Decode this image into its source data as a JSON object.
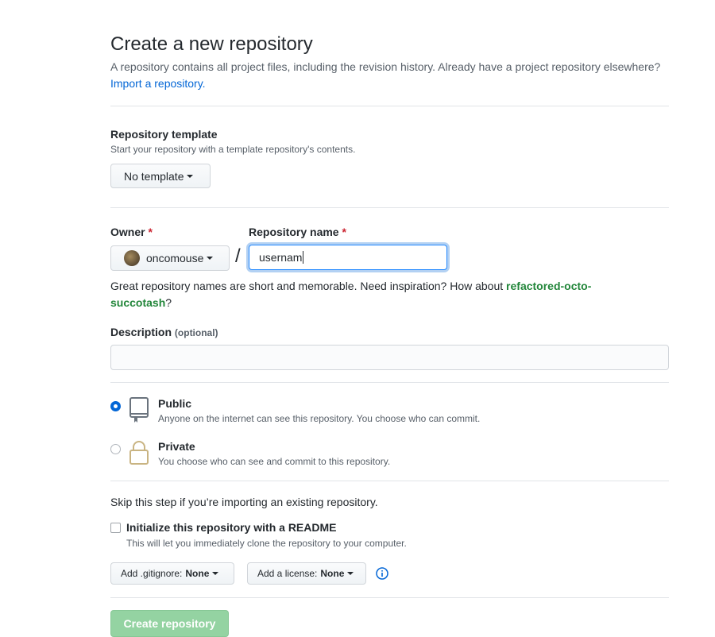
{
  "header": {
    "title": "Create a new repository",
    "intro_text": "A repository contains all project files, including the revision history. Already have a project repository elsewhere?",
    "import_link": "Import a repository."
  },
  "template": {
    "label": "Repository template",
    "note": "Start your repository with a template repository's contents.",
    "button_label": "No template"
  },
  "owner": {
    "label": "Owner",
    "required_mark": "*",
    "value": "oncomouse"
  },
  "separator": "/",
  "repo_name": {
    "label": "Repository name",
    "required_mark": "*",
    "value": "usernam"
  },
  "suggestion": {
    "text": "Great repository names are short and memorable. Need inspiration? How about",
    "name_part1": "refactored-octo-",
    "name_part2": "succotash",
    "end": "?"
  },
  "description": {
    "label": "Description",
    "optional": "(optional)",
    "value": ""
  },
  "visibility": {
    "public_title": "Public",
    "public_desc": "Anyone on the internet can see this repository. You choose who can commit.",
    "private_title": "Private",
    "private_desc": "You choose who can see and commit to this repository.",
    "selected": "public"
  },
  "init": {
    "skip_text": "Skip this step if you’re importing an existing repository.",
    "readme_label": "Initialize this repository with a README",
    "readme_desc": "This will let you immediately clone the repository to your computer.",
    "readme_checked": false
  },
  "gitignore": {
    "label": "Add .gitignore:",
    "value": "None"
  },
  "license": {
    "label": "Add a license:",
    "value": "None"
  },
  "submit": {
    "label": "Create repository"
  },
  "colors": {
    "accent": "#0366d6",
    "required": "#cb2431",
    "submit_disabled": "#94d3a2"
  }
}
